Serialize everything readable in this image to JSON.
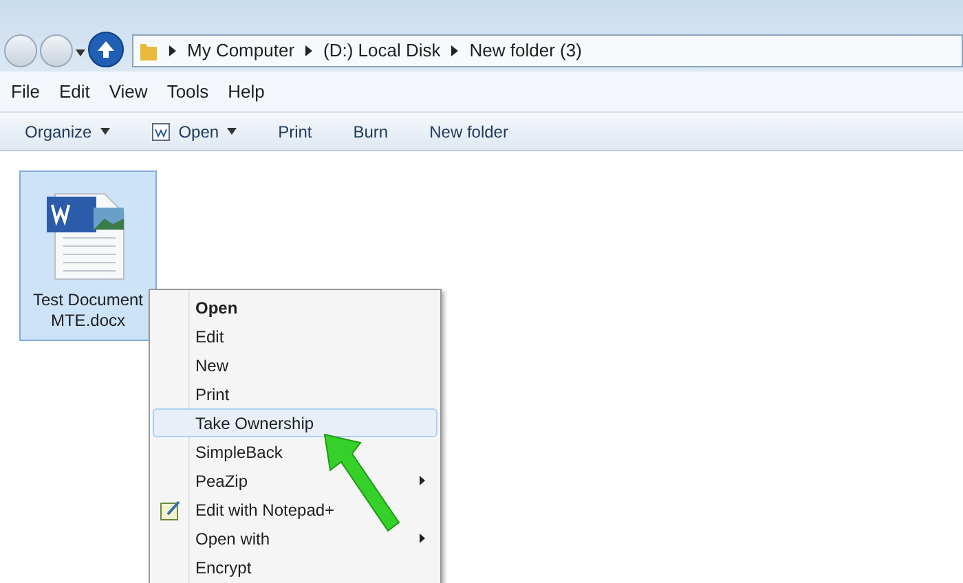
{
  "address_bar": {
    "crumbs": [
      "My Computer",
      "(D:) Local Disk",
      "New folder (3)"
    ]
  },
  "menu_bar": [
    "File",
    "Edit",
    "View",
    "Tools",
    "Help"
  ],
  "toolbar": [
    {
      "label": "Organize",
      "dropdown": true,
      "icon": false
    },
    {
      "label": "Open",
      "dropdown": true,
      "icon": true
    },
    {
      "label": "Print",
      "dropdown": false,
      "icon": false
    },
    {
      "label": "Burn",
      "dropdown": false,
      "icon": false
    },
    {
      "label": "New folder",
      "dropdown": false,
      "icon": false
    }
  ],
  "files": [
    {
      "name": "Test Document MTE.docx",
      "selected": true
    }
  ],
  "context_menu": [
    {
      "label": "Open",
      "bold": true,
      "selected": false,
      "submenu": false,
      "icon": false
    },
    {
      "label": "Edit",
      "bold": false,
      "selected": false,
      "submenu": false,
      "icon": false
    },
    {
      "label": "New",
      "bold": false,
      "selected": false,
      "submenu": false,
      "icon": false
    },
    {
      "label": "Print",
      "bold": false,
      "selected": false,
      "submenu": false,
      "icon": false
    },
    {
      "label": "Take Ownership",
      "bold": false,
      "selected": true,
      "submenu": false,
      "icon": false
    },
    {
      "label": "SimpleBack",
      "bold": false,
      "selected": false,
      "submenu": false,
      "icon": false
    },
    {
      "label": "PeaZip",
      "bold": false,
      "selected": false,
      "submenu": true,
      "icon": false
    },
    {
      "label": "Edit with Notepad+",
      "bold": false,
      "selected": false,
      "submenu": false,
      "icon": true
    },
    {
      "label": "Open with",
      "bold": false,
      "selected": false,
      "submenu": true,
      "icon": false
    },
    {
      "label": "Encrypt",
      "bold": false,
      "selected": false,
      "submenu": false,
      "icon": false
    }
  ]
}
